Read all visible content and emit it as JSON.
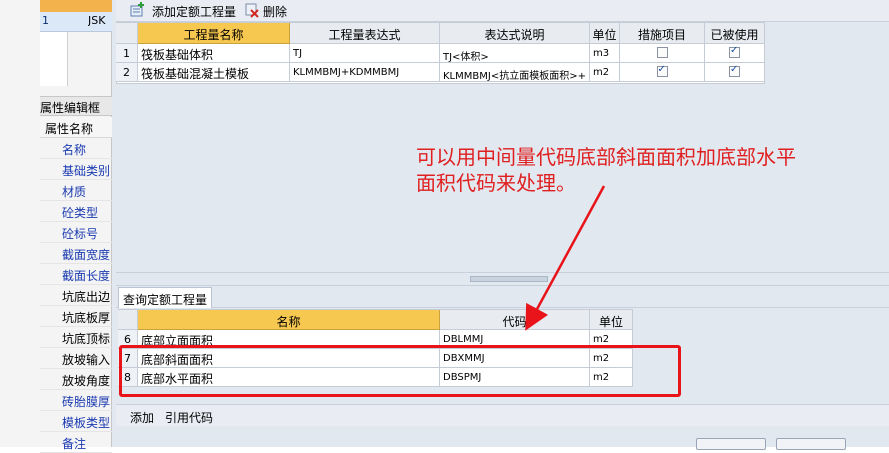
{
  "left_panel": {
    "row1_num": "1",
    "row1_value": "JSK",
    "properties_title": "属性编辑框",
    "properties_header": "属性名称",
    "property_items": [
      {
        "label": "名称",
        "color": "blue"
      },
      {
        "label": "基础类别",
        "color": "blue"
      },
      {
        "label": "材质",
        "color": "blue"
      },
      {
        "label": "砼类型",
        "color": "blue"
      },
      {
        "label": "砼标号",
        "color": "blue"
      },
      {
        "label": "截面宽度",
        "color": "blue"
      },
      {
        "label": "截面长度",
        "color": "blue"
      },
      {
        "label": "坑底出边",
        "color": "black"
      },
      {
        "label": "坑底板厚",
        "color": "black"
      },
      {
        "label": "坑底顶标",
        "color": "black"
      },
      {
        "label": "放坡输入",
        "color": "black"
      },
      {
        "label": "放坡角度",
        "color": "black"
      },
      {
        "label": "砖胎膜厚",
        "color": "blue"
      },
      {
        "label": "模板类型",
        "color": "blue"
      },
      {
        "label": "备注",
        "color": "blue"
      }
    ]
  },
  "toolbar": {
    "add_label": "添加定额工程量",
    "delete_label": "删除"
  },
  "top_grid": {
    "headers": [
      "工程量名称",
      "工程量表达式",
      "表达式说明",
      "单位",
      "措施项目",
      "已被使用"
    ],
    "rows": [
      {
        "num": "1",
        "name": "筏板基础体积",
        "expr": "TJ",
        "desc": "TJ<体积>",
        "unit": "m3",
        "measure": false,
        "used": true
      },
      {
        "num": "2",
        "name": "筏板基础混凝土模板",
        "expr": "KLMMBMJ+KDMMBMJ",
        "desc": "KLMMBMJ<抗立面模板面积>+",
        "unit": "m2",
        "measure": true,
        "used": true
      }
    ]
  },
  "tab": {
    "query_label": "查询定额工程量"
  },
  "bottom_grid": {
    "headers": [
      "名称",
      "代码",
      "单位"
    ],
    "rows": [
      {
        "num": "6",
        "name": "底部立面面积",
        "code": "DBLMMJ",
        "unit": "m2"
      },
      {
        "num": "7",
        "name": "底部斜面面积",
        "code": "DBXMMJ",
        "unit": "m2"
      },
      {
        "num": "8",
        "name": "底部水平面积",
        "code": "DBSPMJ",
        "unit": "m2"
      }
    ]
  },
  "bottom_toolbar": {
    "add_label": "添加",
    "ref_label": "引用代码"
  },
  "annotation": {
    "line1": "可以用中间量代码底部斜面面积加底部水平",
    "line2": "面积代码来处理。",
    "color": "#e02020"
  }
}
